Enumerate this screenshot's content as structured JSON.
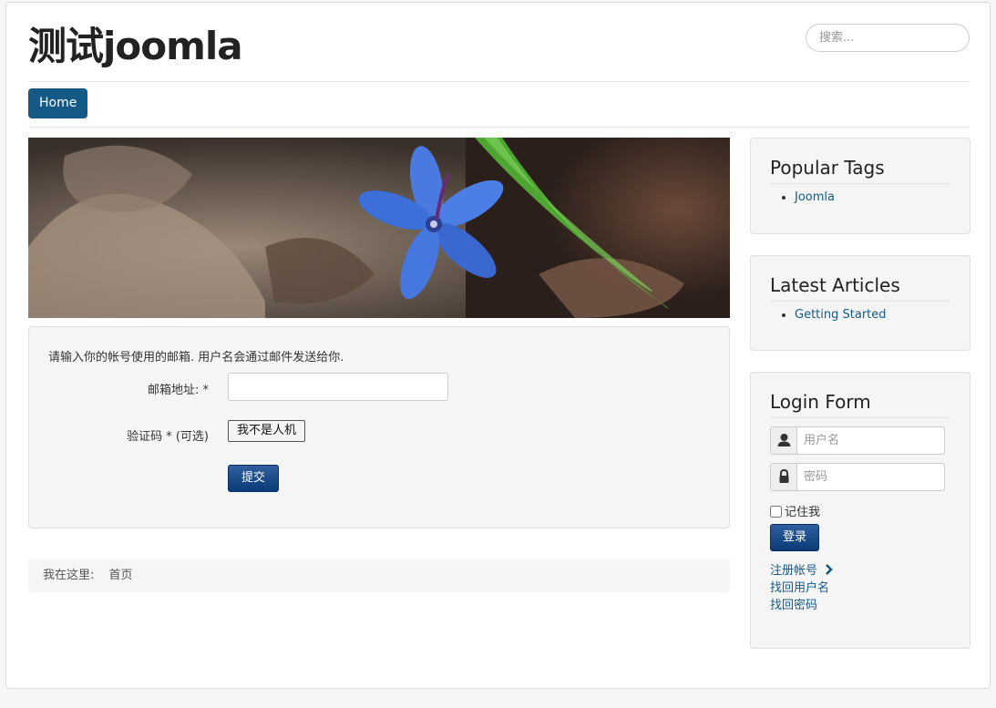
{
  "site": {
    "title": "测试joomla"
  },
  "search": {
    "placeholder": "搜索..."
  },
  "nav": {
    "home": "Home"
  },
  "form": {
    "intro": "请输入你的帐号使用的邮箱. 用户名会通过邮件发送给你.",
    "email_label": "邮箱地址: *",
    "captcha_label": "验证码 * (可选)",
    "captcha_button": "我不是人机",
    "submit": "提交"
  },
  "breadcrumb": {
    "prefix": "我在这里:",
    "home": "首页"
  },
  "popular_tags": {
    "title": "Popular Tags",
    "items": [
      "Joomla"
    ]
  },
  "latest_articles": {
    "title": "Latest Articles",
    "items": [
      "Getting Started"
    ]
  },
  "login": {
    "title": "Login Form",
    "username_placeholder": "用户名",
    "password_placeholder": "密码",
    "remember": "记住我",
    "submit": "登录",
    "register": "注册帐号",
    "forgot_username": "找回用户名",
    "forgot_password": "找回密码"
  },
  "icons": {
    "user": "user-icon",
    "lock": "lock-icon",
    "register_arrow": "chevron-right-icon"
  },
  "colors": {
    "accent": "#155a86",
    "button": "#0b3a78"
  }
}
